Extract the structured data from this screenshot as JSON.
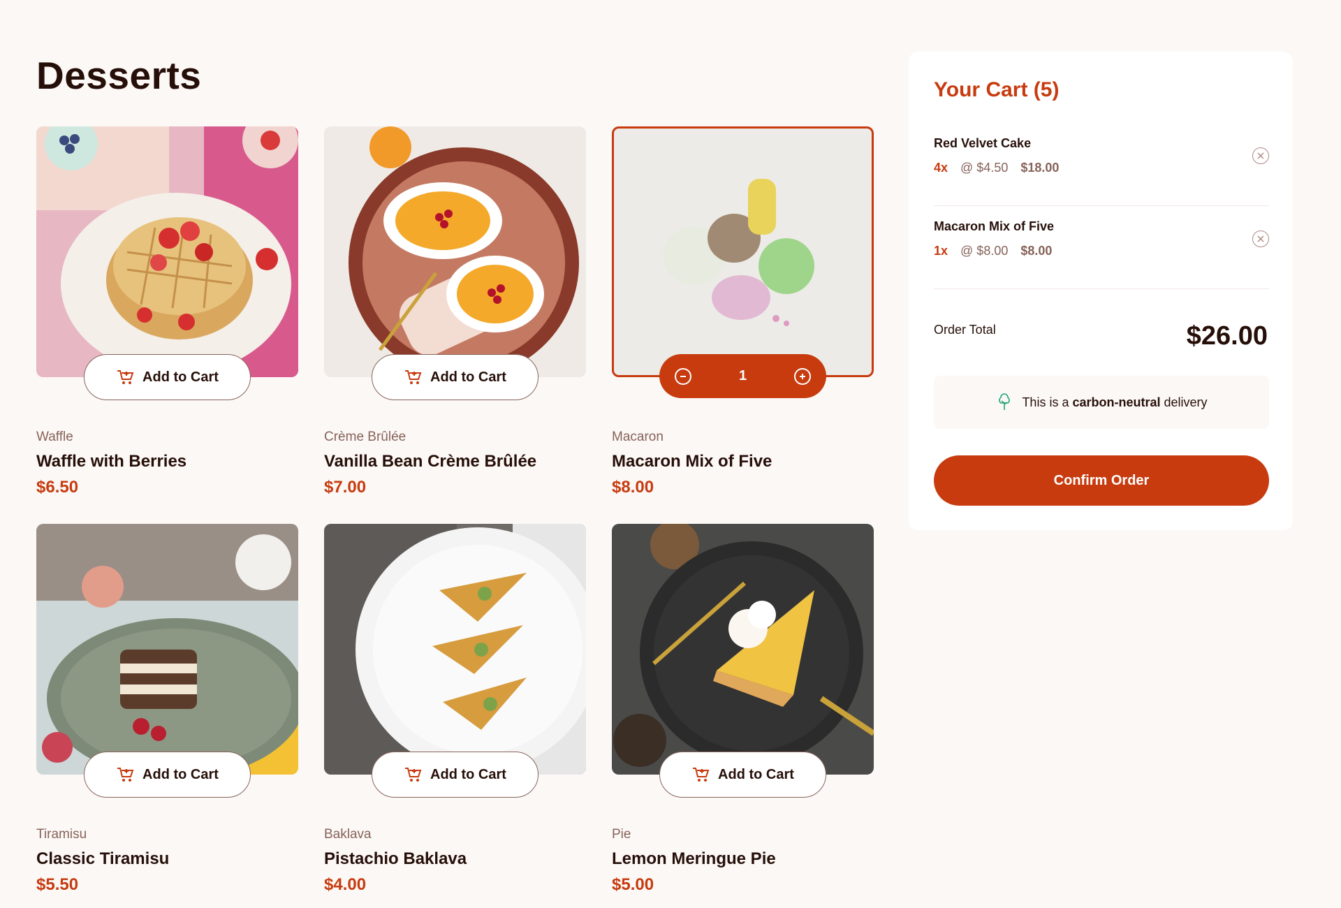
{
  "page": {
    "title": "Desserts"
  },
  "products": [
    {
      "category": "Waffle",
      "name": "Waffle with Berries",
      "price": "$6.50",
      "button": "Add to Cart"
    },
    {
      "category": "Crème Brûlée",
      "name": "Vanilla Bean Crème Brûlée",
      "price": "$7.00",
      "button": "Add to Cart"
    },
    {
      "category": "Macaron",
      "name": "Macaron Mix of Five",
      "price": "$8.00",
      "quantity": "1"
    },
    {
      "category": "Tiramisu",
      "name": "Classic Tiramisu",
      "price": "$5.50",
      "button": "Add to Cart"
    },
    {
      "category": "Baklava",
      "name": "Pistachio Baklava",
      "price": "$4.00",
      "button": "Add to Cart"
    },
    {
      "category": "Pie",
      "name": "Lemon Meringue Pie",
      "price": "$5.00",
      "button": "Add to Cart"
    }
  ],
  "cart": {
    "title": "Your Cart (5)",
    "items": [
      {
        "name": "Red Velvet Cake",
        "qty": "4x",
        "unit": "@ $4.50",
        "total": "$18.00"
      },
      {
        "name": "Macaron Mix of Five",
        "qty": "1x",
        "unit": "@ $8.00",
        "total": "$8.00"
      }
    ],
    "order_total_label": "Order Total",
    "order_total": "$26.00",
    "carbon_prefix": "This is a",
    "carbon_bold": "carbon-neutral",
    "carbon_suffix": "delivery",
    "confirm_label": "Confirm Order"
  },
  "colors": {
    "accent": "#c73b0f",
    "text": "#260f08",
    "muted": "#87635a",
    "background": "#fcf8f6"
  },
  "icons": [
    "add-to-cart-icon",
    "decrement-icon",
    "increment-icon",
    "remove-item-icon",
    "carbon-neutral-tree-icon"
  ]
}
